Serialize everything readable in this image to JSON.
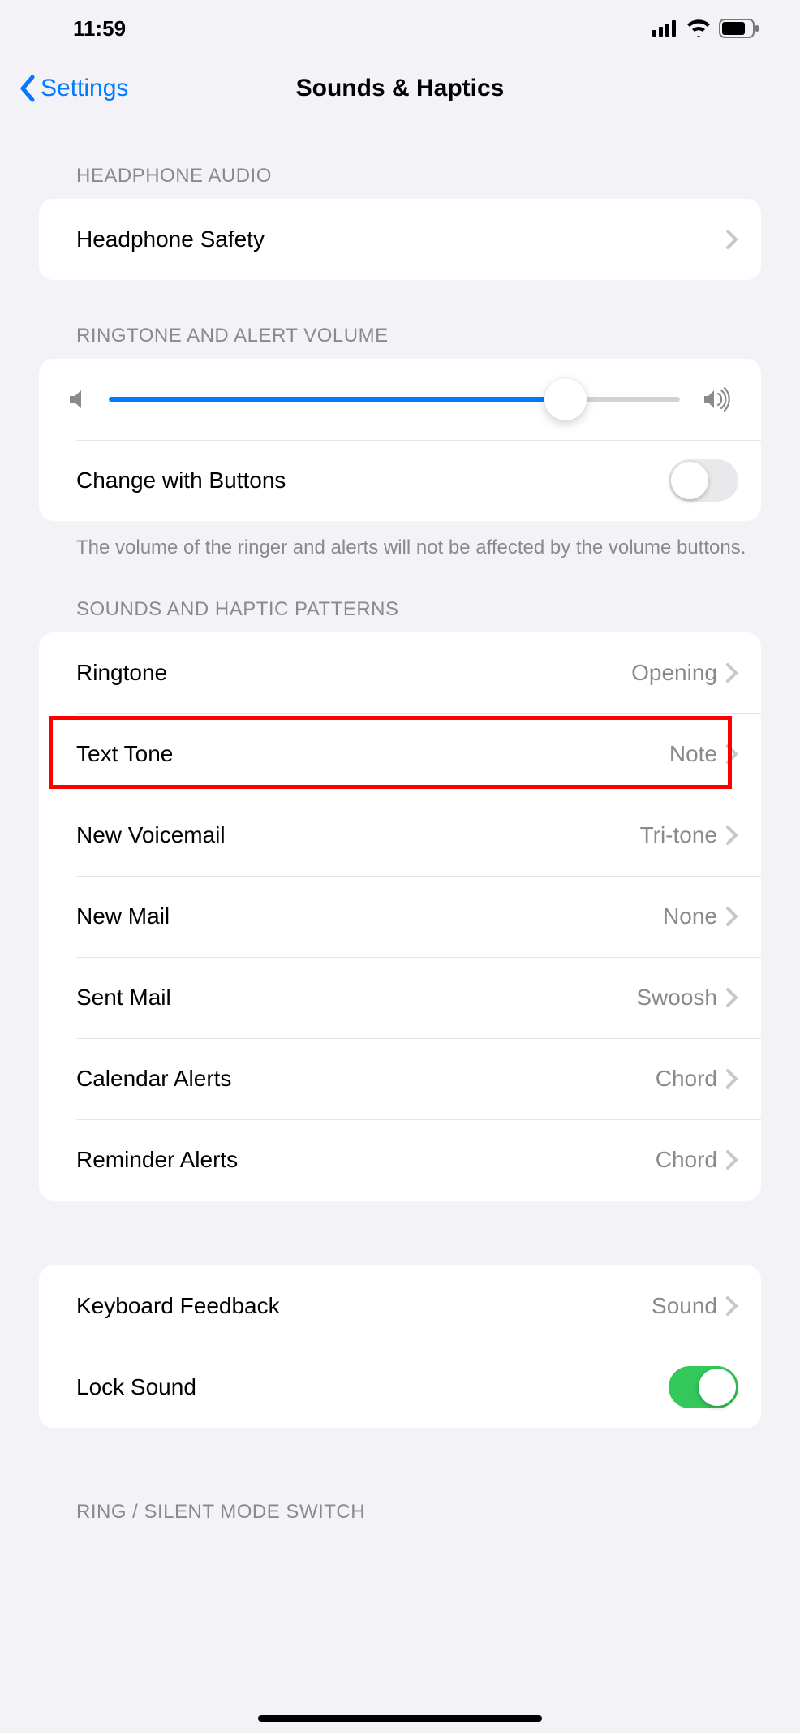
{
  "status": {
    "time": "11:59"
  },
  "nav": {
    "back_label": "Settings",
    "title": "Sounds & Haptics"
  },
  "sections": {
    "headphone": {
      "header": "HEADPHONE AUDIO",
      "safety_label": "Headphone Safety"
    },
    "volume": {
      "header": "RINGTONE AND ALERT VOLUME",
      "slider_percent": 80,
      "change_with_buttons_label": "Change with Buttons",
      "change_with_buttons_on": false,
      "footer": "The volume of the ringer and alerts will not be affected by the volume buttons."
    },
    "patterns": {
      "header": "SOUNDS AND HAPTIC PATTERNS",
      "items": [
        {
          "label": "Ringtone",
          "value": "Opening"
        },
        {
          "label": "Text Tone",
          "value": "Note"
        },
        {
          "label": "New Voicemail",
          "value": "Tri-tone"
        },
        {
          "label": "New Mail",
          "value": "None"
        },
        {
          "label": "Sent Mail",
          "value": "Swoosh"
        },
        {
          "label": "Calendar Alerts",
          "value": "Chord"
        },
        {
          "label": "Reminder Alerts",
          "value": "Chord"
        }
      ]
    },
    "keyboard": {
      "keyboard_feedback_label": "Keyboard Feedback",
      "keyboard_feedback_value": "Sound",
      "lock_sound_label": "Lock Sound",
      "lock_sound_on": true
    },
    "ring_silent": {
      "header_partial": "RING / SILENT MODE SWITCH"
    }
  },
  "annotation": {
    "highlighted_row_index": 1
  }
}
